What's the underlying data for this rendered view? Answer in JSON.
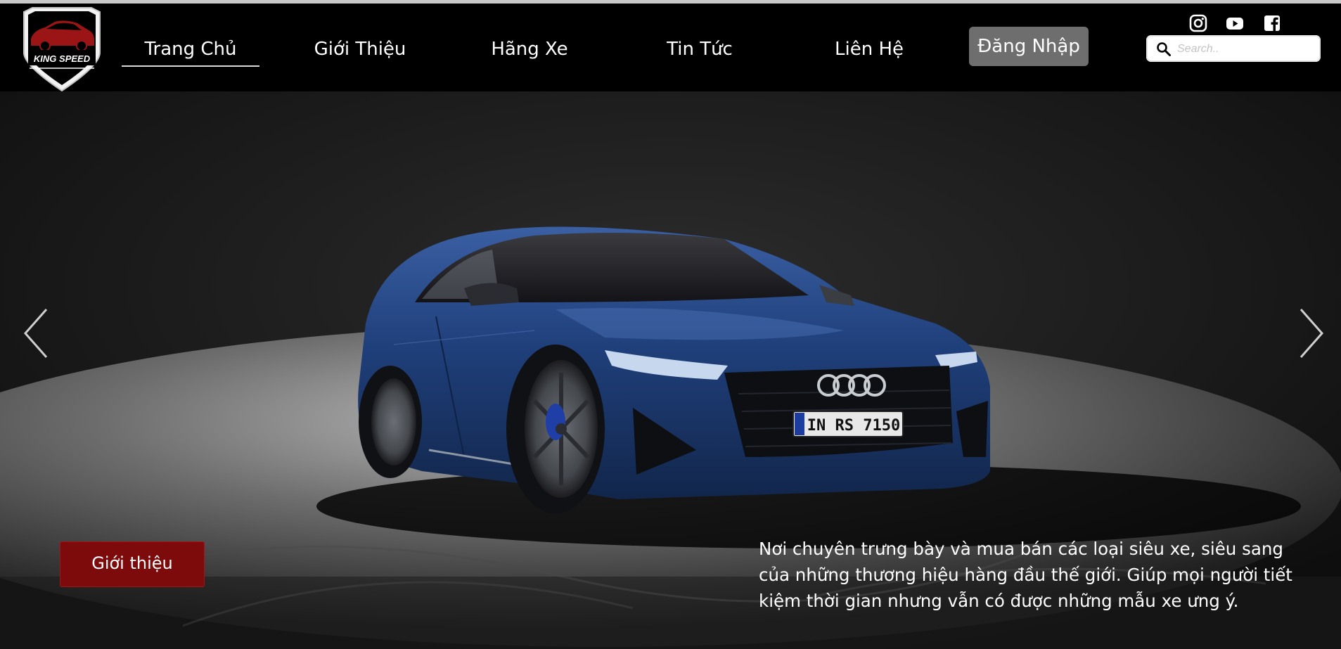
{
  "brand": {
    "name": "KING SPEED"
  },
  "nav": {
    "items": [
      {
        "label": "Trang Chủ",
        "active": true
      },
      {
        "label": "Giới Thiệu",
        "active": false
      },
      {
        "label": "Hãng Xe",
        "active": false
      },
      {
        "label": "Tin Tức",
        "active": false
      },
      {
        "label": "Liên Hệ",
        "active": false
      }
    ],
    "login_label": "Đăng Nhập"
  },
  "search": {
    "placeholder": "Search..",
    "value": ""
  },
  "social": [
    "instagram-icon",
    "youtube-icon",
    "facebook-icon"
  ],
  "hero": {
    "plate": "IN RS 7150",
    "button_label": "Giới thiệu",
    "description": "Nơi chuyên trưng bày và mua bán các loại siêu xe, siêu sang của những thương hiệu hàng đầu thế giới. Giúp mọi người tiết kiệm thời gian nhưng vẫn có được những mẫu xe ưng ý."
  },
  "colors": {
    "header_bg": "#000000",
    "login_bg": "#6e6e6e",
    "hero_button_bg": "#7e0b0c",
    "car_blue": "#1d3a6e"
  }
}
